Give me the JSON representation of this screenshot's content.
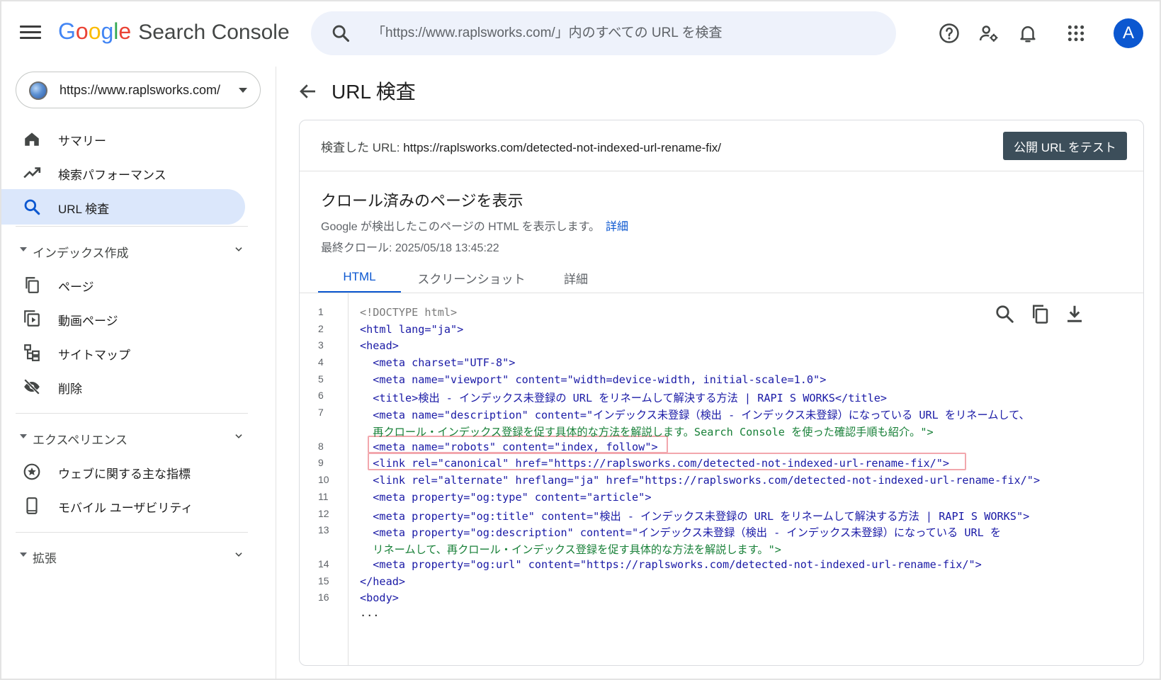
{
  "header": {
    "logo_letters": [
      "G",
      "o",
      "o",
      "g",
      "l",
      "e"
    ],
    "product": "Search Console",
    "search_placeholder": "「https://www.raplsworks.com/」内のすべての URL を検査",
    "avatar_letter": "A",
    "icons": [
      "help-icon",
      "manage-users-icon",
      "notifications-icon",
      "apps-icon"
    ]
  },
  "sidebar": {
    "property": "https://www.raplsworks.com/",
    "items": [
      {
        "label": "サマリー",
        "icon": "home-icon"
      },
      {
        "label": "検索パフォーマンス",
        "icon": "trending-up-icon"
      },
      {
        "label": "URL 検査",
        "icon": "search-icon"
      }
    ],
    "sections": [
      {
        "label": "インデックス作成",
        "items": [
          {
            "label": "ページ",
            "icon": "pages-icon"
          },
          {
            "label": "動画ページ",
            "icon": "video-pages-icon"
          },
          {
            "label": "サイトマップ",
            "icon": "sitemap-icon"
          },
          {
            "label": "削除",
            "icon": "removals-icon"
          }
        ]
      },
      {
        "label": "エクスペリエンス",
        "items": [
          {
            "label": "ウェブに関する主な指標",
            "icon": "core-web-vitals-icon"
          },
          {
            "label": "モバイル ユーザビリティ",
            "icon": "mobile-icon"
          }
        ]
      },
      {
        "label": "拡張",
        "items": []
      }
    ]
  },
  "main": {
    "title": "URL 検査",
    "inspected_label": "検査した URL:",
    "inspected_url": "https://raplsworks.com/detected-not-indexed-url-rename-fix/",
    "test_button": "公開 URL をテスト",
    "crawl_title": "クロール済みのページを表示",
    "crawl_desc": "Google が検出したこのページの HTML を表示します。",
    "crawl_desc_link": "詳細",
    "last_crawl": "最終クロール: 2025/05/18 13:45:22",
    "tabs": [
      "HTML",
      "スクリーンショット",
      "詳細"
    ],
    "active_tab": "HTML"
  },
  "code": {
    "line_numbers": [
      "1",
      "2",
      "3",
      "4",
      "5",
      "6",
      "7",
      "8",
      "9",
      "10",
      "11",
      "12",
      "13",
      "14",
      "15",
      "16"
    ],
    "lines": [
      "<!DOCTYPE html>",
      "<html lang=\"ja\">",
      "<head>",
      "  <meta charset=\"UTF-8\">",
      "  <meta name=\"viewport\" content=\"width=device-width, initial-scale=1.0\">",
      "  <title>検出 - インデックス未登録の URL をリネームして解決する方法 | RAPI S WORKS</title>",
      "  <meta name=\"description\" content=\"インデックス未登録（検出 - インデックス未登録）になっている URL をリネームして、",
      "  再クロール・インデックス登録を促す具体的な方法を解説します。Search Console を使った確認手順も紹介。\">",
      "  <meta name=\"robots\" content=\"index, follow\">",
      "  <link rel=\"canonical\" href=\"https://raplsworks.com/detected-not-indexed-url-rename-fix/\">",
      "  <link rel=\"alternate\" hreflang=\"ja\" href=\"https://raplsworks.com/detected-not-indexed-url-rename-fix/\">",
      "  <meta property=\"og:type\" content=\"article\">",
      "  <meta property=\"og:title\" content=\"検出 - インデックス未登録の URL をリネームして解決する方法 | RAPI S WORKS\">",
      "  <meta property=\"og:description\" content=\"インデックス未登録（検出 - インデックス未登録）になっている URL を",
      "  リネームして、再クロール・インデックス登録を促す具体的な方法を解説します。\">",
      "  <meta property=\"og:url\" content=\"https://raplsworks.com/detected-not-indexed-url-rename-fix/\">",
      "</head>",
      "<body>",
      "..."
    ]
  },
  "colors": {
    "accent": "#0b57d0",
    "active_nav_bg": "#dbe7fb",
    "tag": "#1a1aa6",
    "value": "#188038",
    "highlight_border": "#f2a7ad",
    "button_bg": "#3c4e5a"
  }
}
